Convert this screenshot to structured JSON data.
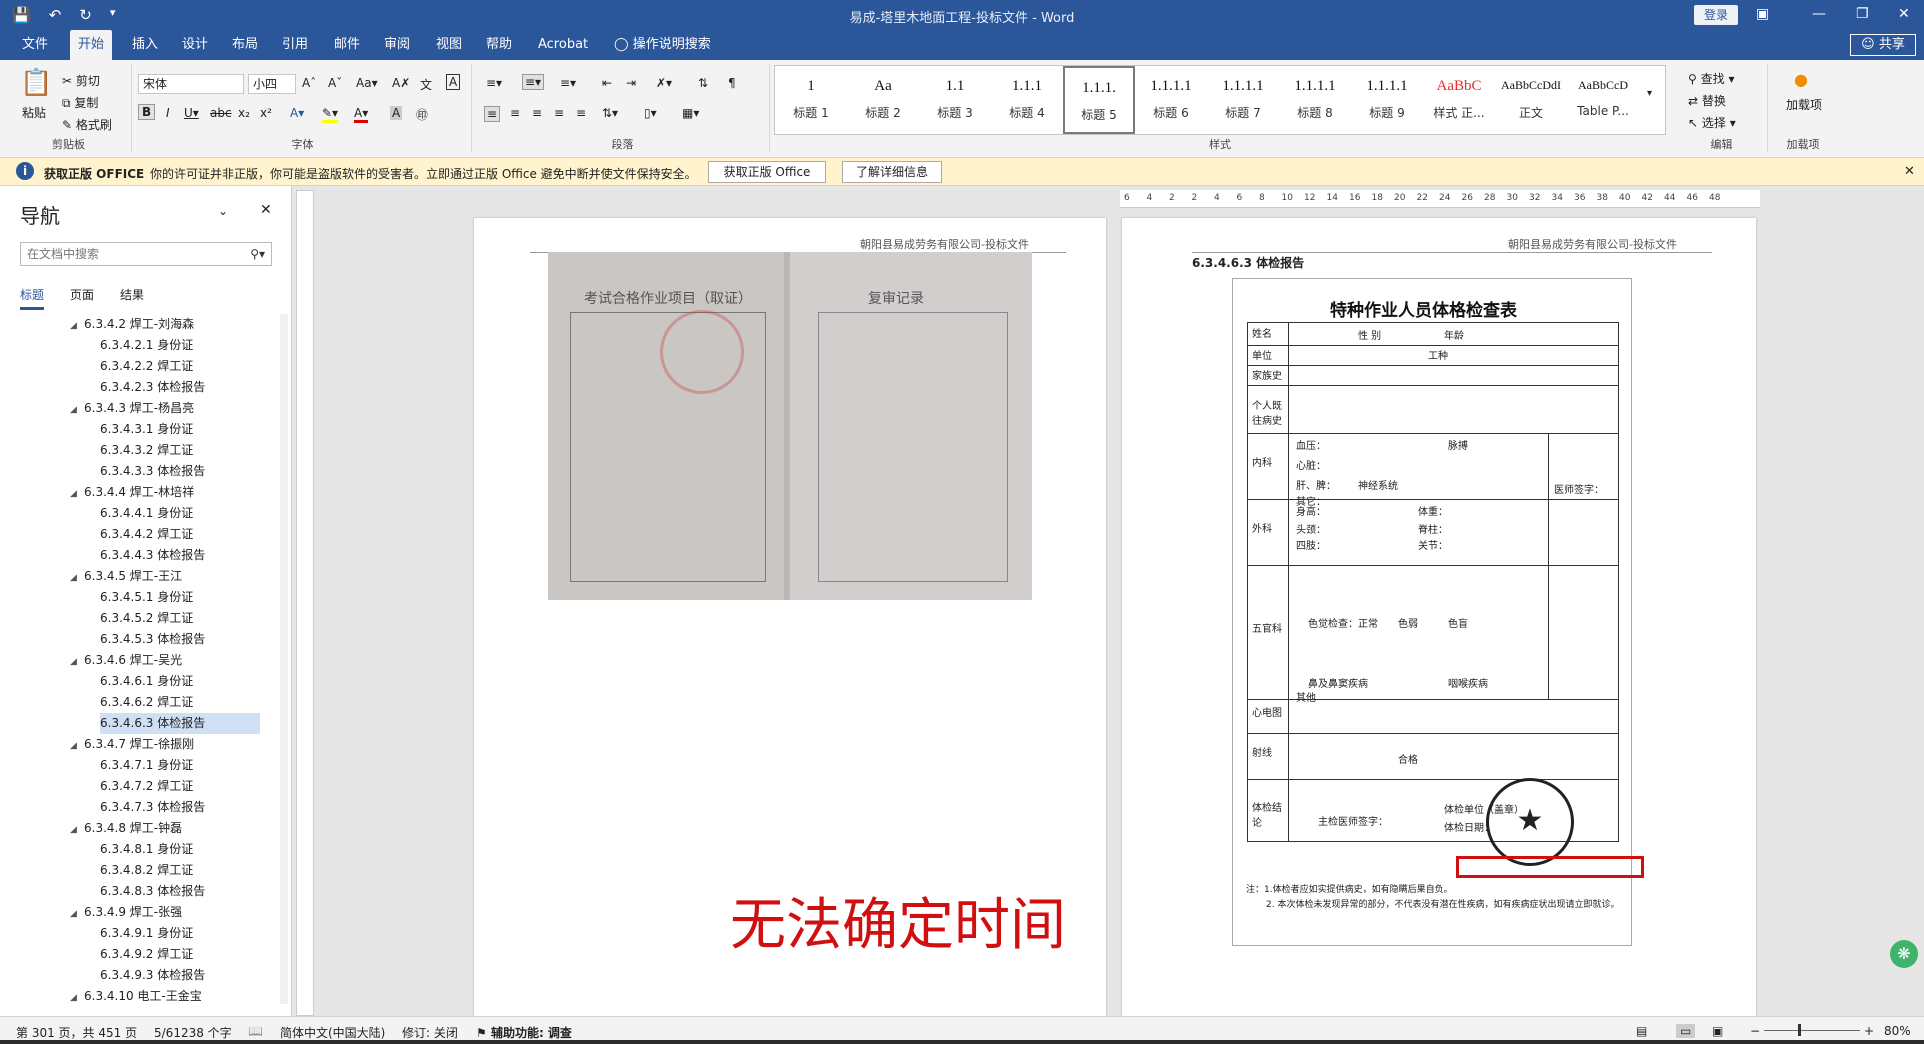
{
  "window": {
    "title": "易成-塔里木地面工程-投标文件  -  Word",
    "login": "登录",
    "share": "共享"
  },
  "tabs": [
    "文件",
    "开始",
    "插入",
    "设计",
    "布局",
    "引用",
    "邮件",
    "审阅",
    "视图",
    "帮助",
    "Acrobat",
    "操作说明搜索"
  ],
  "ribbon": {
    "clipboard": {
      "paste": "粘贴",
      "cut": "剪切",
      "copy": "复制",
      "format_painter": "格式刷",
      "label": "剪贴板"
    },
    "font": {
      "name": "宋体",
      "size": "小四",
      "label": "字体"
    },
    "paragraph": {
      "label": "段落"
    },
    "styles": {
      "label": "样式",
      "items": [
        {
          "preview": "1",
          "name": "标题 1"
        },
        {
          "preview": "Aa",
          "name": "标题 2"
        },
        {
          "preview": "1.1",
          "name": "标题 3"
        },
        {
          "preview": "1.1.1",
          "name": "标题 4"
        },
        {
          "preview": "1.1.1.",
          "name": "标题 5"
        },
        {
          "preview": "1.1.1.1",
          "name": "标题 6"
        },
        {
          "preview": "1.1.1.1",
          "name": "标题 7"
        },
        {
          "preview": "1.1.1.1",
          "name": "标题 8"
        },
        {
          "preview": "1.1.1.1",
          "name": "标题 9"
        },
        {
          "preview": "AaBbC",
          "name": "样式 正..."
        },
        {
          "preview": "AaBbCcDdI",
          "name": "正文"
        },
        {
          "preview": "AaBbCcD",
          "name": "Table P..."
        }
      ]
    },
    "editing": {
      "find": "查找",
      "replace": "替换",
      "select": "选择",
      "label": "编辑"
    },
    "addins": {
      "add": "加载项",
      "label": "加载项"
    }
  },
  "infobar": {
    "title": "获取正版 OFFICE",
    "message": "你的许可证并非正版，你可能是盗版软件的受害者。立即通过正版 Office 避免中断并使文件保持安全。",
    "btn_get": "获取正版 Office",
    "btn_more": "了解详细信息"
  },
  "nav": {
    "title": "导航",
    "search_placeholder": "在文档中搜索",
    "tabs": [
      "标题",
      "页面",
      "结果"
    ],
    "items": [
      {
        "text": "6.3.4.2 焊工-刘海森",
        "level": 1
      },
      {
        "text": "6.3.4.2.1 身份证",
        "level": 2
      },
      {
        "text": "6.3.4.2.2 焊工证",
        "level": 2
      },
      {
        "text": "6.3.4.2.3 体检报告",
        "level": 2
      },
      {
        "text": "6.3.4.3 焊工-杨昌亮",
        "level": 1
      },
      {
        "text": "6.3.4.3.1 身份证",
        "level": 2
      },
      {
        "text": "6.3.4.3.2 焊工证",
        "level": 2
      },
      {
        "text": "6.3.4.3.3 体检报告",
        "level": 2
      },
      {
        "text": "6.3.4.4 焊工-林培祥",
        "level": 1
      },
      {
        "text": "6.3.4.4.1 身份证",
        "level": 2
      },
      {
        "text": "6.3.4.4.2 焊工证",
        "level": 2
      },
      {
        "text": "6.3.4.4.3 体检报告",
        "level": 2
      },
      {
        "text": "6.3.4.5 焊工-王江",
        "level": 1
      },
      {
        "text": "6.3.4.5.1 身份证",
        "level": 2
      },
      {
        "text": "6.3.4.5.2 焊工证",
        "level": 2
      },
      {
        "text": "6.3.4.5.3 体检报告",
        "level": 2
      },
      {
        "text": "6.3.4.6 焊工-吴光",
        "level": 1
      },
      {
        "text": "6.3.4.6.1 身份证",
        "level": 2
      },
      {
        "text": "6.3.4.6.2 焊工证",
        "level": 2
      },
      {
        "text": "6.3.4.6.3 体检报告",
        "level": 2,
        "selected": true
      },
      {
        "text": "6.3.4.7 焊工-徐振刚",
        "level": 1
      },
      {
        "text": "6.3.4.7.1 身份证",
        "level": 2
      },
      {
        "text": "6.3.4.7.2 焊工证",
        "level": 2
      },
      {
        "text": "6.3.4.7.3 体检报告",
        "level": 2
      },
      {
        "text": "6.3.4.8 焊工-钟磊",
        "level": 1
      },
      {
        "text": "6.3.4.8.1 身份证",
        "level": 2
      },
      {
        "text": "6.3.4.8.2 焊工证",
        "level": 2
      },
      {
        "text": "6.3.4.8.3 体检报告",
        "level": 2
      },
      {
        "text": "6.3.4.9 焊工-张强",
        "level": 1
      },
      {
        "text": "6.3.4.9.1 身份证",
        "level": 2
      },
      {
        "text": "6.3.4.9.2 焊工证",
        "level": 2
      },
      {
        "text": "6.3.4.9.3 体检报告",
        "level": 2
      },
      {
        "text": "6.3.4.10 电工-王金宝",
        "level": 1
      }
    ]
  },
  "document": {
    "header_left": "朝阳县易成劳务有限公司-投标文件",
    "header_right": "朝阳县易成劳务有限公司-投标文件",
    "section_heading": "6.3.4.6.3  体检报告",
    "annotation": "无法确定时间",
    "photo": {
      "left_title": "考试合格作业项目（取证）",
      "right_title": "复审记录"
    },
    "form": {
      "title": "特种作业人员体格检查表",
      "row_labels": [
        "姓名",
        "单位",
        "家族史",
        "个人既往病史",
        "内科",
        "外科",
        "五官科",
        "心电图",
        "射线",
        "体检结论"
      ],
      "fields": [
        "性 别",
        "年龄",
        "工种",
        "血压：",
        "脉搏",
        "心脏：",
        "肝、脾：",
        "神经系统",
        "其它：",
        "身高：",
        "体重：",
        "头颈：",
        "脊柱：",
        "四肢：",
        "关节：",
        "色觉检查：正常",
        "色弱",
        "色盲",
        "鼻及鼻窦疾病",
        "咽喉疾病",
        "其他",
        "合格",
        "主检医师签字：",
        "体检单位（盖章）",
        "体检日期：",
        "医师签字："
      ],
      "notes": [
        "注：1.体检者应如实提供病史，如有隐瞒后果自负。",
        "2. 本次体检未发现异常的部分，不代表没有潜在性疾病，如有疾病症状出现请立即就诊。"
      ]
    }
  },
  "ruler": {
    "numbers": [
      "6",
      "4",
      "2",
      "2",
      "4",
      "6",
      "8",
      "10",
      "12",
      "14",
      "16",
      "18",
      "20",
      "22",
      "24",
      "26",
      "28",
      "30",
      "32",
      "34",
      "36",
      "38",
      "40",
      "42",
      "44",
      "46",
      "48"
    ]
  },
  "status": {
    "page": "第 301 页，共 451 页",
    "words": "5/61238 个字",
    "lang": "简体中文(中国大陆)",
    "track": "修订: 关闭",
    "access": "辅助功能: 调查",
    "zoom": "80%"
  }
}
